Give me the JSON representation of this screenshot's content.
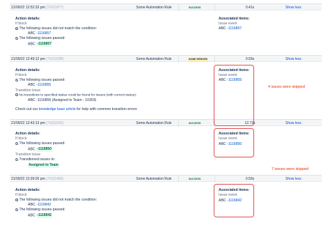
{
  "rows": [
    {
      "date": "21/09/22 12:52:33 pm",
      "uid": "(71611877)",
      "rule": "Some Automation Rule",
      "status": "SUCCESS",
      "duration": "0.41s",
      "toggle": "Show less"
    },
    {
      "date": "21/09/22 12:49:12 pm",
      "uid": "(71611598)",
      "rule": "Some Automation Rule",
      "status": "SOME ERRORS",
      "duration": "0.59s",
      "toggle": "Show less"
    },
    {
      "date": "21/09/22 12:43:13 pm",
      "uid": "(71611543)",
      "rule": "Some Automation Rule",
      "status": "SUCCESS",
      "duration": "12.73s",
      "toggle": "Show less"
    },
    {
      "date": "21/09/22 12:39:26 pm",
      "uid": "(71611465)",
      "rule": "Some Automation Rule",
      "status": "SUCCESS",
      "duration": "0.59s",
      "toggle": "Show less"
    }
  ],
  "details": {
    "d1": {
      "action_details": "Action details:",
      "if_block": "If block",
      "not_match": "The following issues did not match the condition:",
      "not_match_issue_prefix": "ABC",
      "not_match_issue": "-1116857",
      "passed": "The following issues passed:",
      "passed_issue_prefix": "ABC",
      "passed_issue": "-1116857",
      "assoc_title": "Associated items:",
      "assoc_type": "Issue event",
      "assoc_prefix": "ABC",
      "assoc_issue": "-1116857"
    },
    "d2": {
      "action_details": "Action details:",
      "if_block": "If block",
      "passed": "The following issues passed:",
      "passed_issue_prefix": "ABC",
      "passed_issue": "-1116855",
      "transition": "Transition issue",
      "no_transitions": "No transitions to specified status could be found for issues (with current status):",
      "nt_issue_prefix": "ABC",
      "nt_issue": "-1116855 (Assigned to Team - 10303)",
      "checkout_pre": "Check out our",
      "checkout_link": "knowledge base article",
      "checkout_post": "for help with common transition errors",
      "assoc_title": "Associated items:",
      "assoc_type": "Issue event",
      "assoc_prefix": "ABC",
      "assoc_issue": "-1116855",
      "note": "4 issues were skipped"
    },
    "d3": {
      "action_details": "Action details:",
      "if_block": "If block",
      "passed": "The following issues passed:",
      "passed_issue_prefix": "ABC",
      "passed_issue": "-1116850",
      "transition": "Transition issue",
      "transitioned": "Transitioned issues to:",
      "transitioned_to": "Assigned to Team",
      "assoc_title": "Associated items:",
      "assoc_type": "Issue event",
      "assoc_prefix": "ABC",
      "assoc_issue": "-1116850",
      "note": "7 issues were skipped"
    },
    "d4": {
      "action_details": "Action details:",
      "if_block": "If block",
      "not_match": "The following issues did not match the condition:",
      "not_match_issue_prefix": "ABC",
      "not_match_issue": "-1116842",
      "passed": "The following issues passed:",
      "passed_issue_prefix": "ABC",
      "passed_issue": "-1116842",
      "assoc_title": "Associated items:",
      "assoc_type": "Issue event",
      "assoc_prefix": "ABC",
      "assoc_issue": "-1116842"
    }
  },
  "icons": {
    "passed": "check-circle-icon",
    "not_matched": "minus-circle-icon",
    "info": "info-circle-icon"
  },
  "colors": {
    "success": "#006644",
    "errors_bg": "#fff0b3",
    "link": "#0052cc",
    "highlight": "#e04f4f"
  }
}
